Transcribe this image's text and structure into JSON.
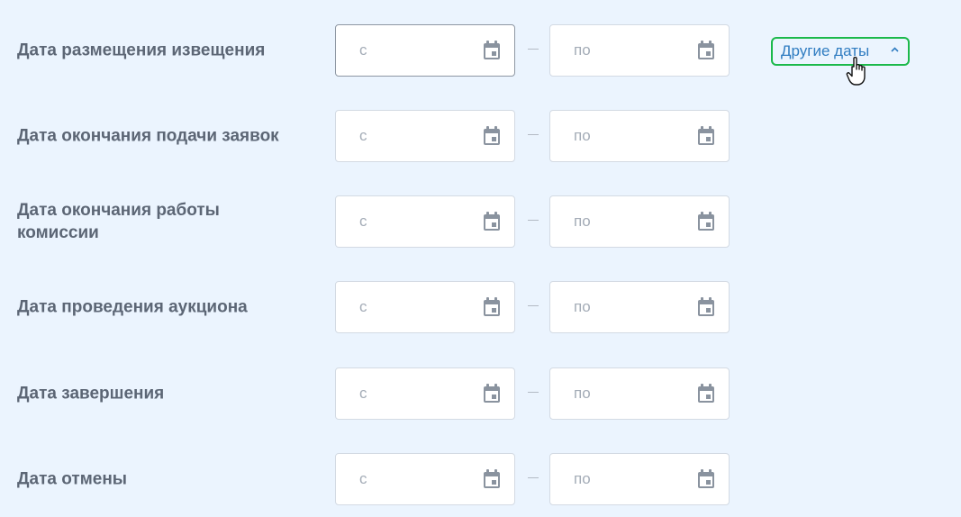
{
  "rows": [
    {
      "label": "Дата размещения извещения",
      "from_placeholder": "с",
      "to_placeholder": "по"
    },
    {
      "label": "Дата окончания подачи заявок",
      "from_placeholder": "с",
      "to_placeholder": "по"
    },
    {
      "label": "Дата окончания работы\nкомиссии",
      "from_placeholder": "с",
      "to_placeholder": "по"
    },
    {
      "label": "Дата проведения аукциона",
      "from_placeholder": "с",
      "to_placeholder": "по"
    },
    {
      "label": "Дата завершения",
      "from_placeholder": "с",
      "to_placeholder": "по"
    },
    {
      "label": "Дата отмены",
      "from_placeholder": "с",
      "to_placeholder": "по"
    }
  ],
  "other_dates_label": "Другие даты",
  "icons": {
    "calendar": "calendar-icon",
    "chevron": "chevron-up-icon",
    "cursor": "hand-pointer-icon"
  },
  "colors": {
    "background": "#ebf4fe",
    "label": "#5c6675",
    "link": "#2f7cc1",
    "highlight_border": "#1cb94b",
    "placeholder": "#a4acb7"
  }
}
